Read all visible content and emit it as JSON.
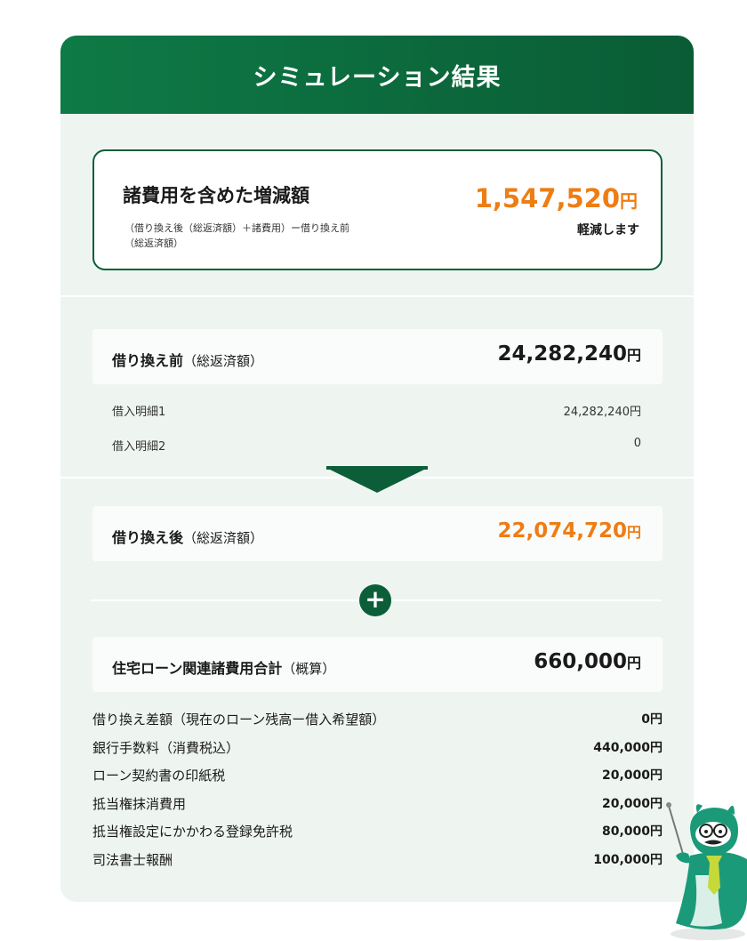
{
  "header": {
    "title": "シミュレーション結果"
  },
  "summary": {
    "title": "諸費用を含めた増減額",
    "note_line1": "（借り換え後（総返済額）＋諸費用）ー借り換え前",
    "note_line2": "（総返済額）",
    "amount": "1,547,520",
    "yen": "円",
    "result": "軽減します"
  },
  "before": {
    "label": "借り換え前",
    "sub": "（総返済額）",
    "amount": "24,282,240",
    "yen": "円",
    "items": [
      {
        "label": "借入明細1",
        "value": "24,282,240円"
      },
      {
        "label": "借入明細2",
        "value": "0"
      }
    ]
  },
  "after": {
    "label": "借り換え後",
    "sub": "（総返済額）",
    "amount": "22,074,720",
    "yen": "円"
  },
  "plus_symbol": "+",
  "fees": {
    "label": "住宅ローン関連諸費用合計",
    "sub": "（概算）",
    "amount": "660,000",
    "yen": "円",
    "items": [
      {
        "label": "借り換え差額（現在のローン残高ー借入希望額）",
        "value": "0円"
      },
      {
        "label": "銀行手数料（消費税込）",
        "value": "440,000円"
      },
      {
        "label": "ローン契約書の印紙税",
        "value": "20,000円"
      },
      {
        "label": "抵当権抹消費用",
        "value": "20,000円"
      },
      {
        "label": "抵当権設定にかかわる登録免許税",
        "value": "80,000円"
      },
      {
        "label": "司法書士報酬",
        "value": "100,000円"
      }
    ]
  },
  "colors": {
    "brand_green": "#0b5e38",
    "accent_orange": "#ee7d14",
    "panel_bg": "#eef5f1"
  },
  "icons": {
    "mascot": "mascot-character-icon",
    "plus": "plus-icon",
    "arrow": "down-arrow-icon"
  }
}
